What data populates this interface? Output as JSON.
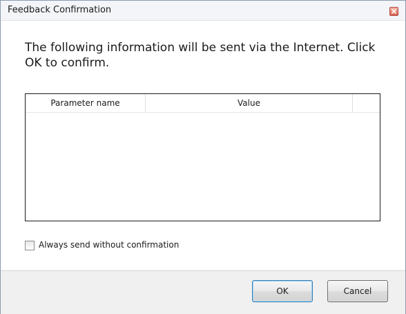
{
  "window": {
    "title": "Feedback Confirmation"
  },
  "message": "The following information will be sent via the Internet. Click OK to confirm.",
  "table": {
    "columns": [
      "Parameter name",
      "Value",
      ""
    ],
    "rows": []
  },
  "checkbox": {
    "label": "Always send without confirmation",
    "checked": false
  },
  "buttons": {
    "ok": "OK",
    "cancel": "Cancel"
  },
  "icons": {
    "close": "close-icon"
  },
  "colors": {
    "dialog_background": "#f0f0f0",
    "content_background": "#ffffff",
    "close_button": "#d9604a",
    "default_button_border": "#3c7fb1"
  }
}
